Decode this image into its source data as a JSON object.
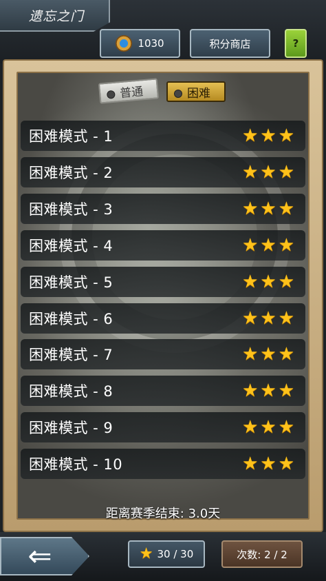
{
  "header": {
    "title": "遗忘之门",
    "score": "1030",
    "shop_label": "积分商店",
    "help_label": "?"
  },
  "mode_tabs": {
    "normal": "普通",
    "hard": "困难",
    "selected": "hard"
  },
  "levels": [
    {
      "name": "困难模式 - 1",
      "stars": 3
    },
    {
      "name": "困难模式 - 2",
      "stars": 3
    },
    {
      "name": "困难模式 - 3",
      "stars": 3
    },
    {
      "name": "困难模式 - 4",
      "stars": 3
    },
    {
      "name": "困难模式 - 5",
      "stars": 3
    },
    {
      "name": "困难模式 - 6",
      "stars": 3
    },
    {
      "name": "困难模式 - 7",
      "stars": 3
    },
    {
      "name": "困难模式 - 8",
      "stars": 3
    },
    {
      "name": "困难模式 - 9",
      "stars": 3
    },
    {
      "name": "困难模式 - 10",
      "stars": 3
    }
  ],
  "season_text": "距离赛季结束: 3.0天",
  "footer": {
    "back_icon": "back-arrow-icon",
    "stars_total": "30 / 30",
    "attempts": "次数: 2 / 2"
  },
  "colors": {
    "star": "#ffc21a",
    "hard_tab": "#d2a83c",
    "frame": "#c9b086"
  }
}
